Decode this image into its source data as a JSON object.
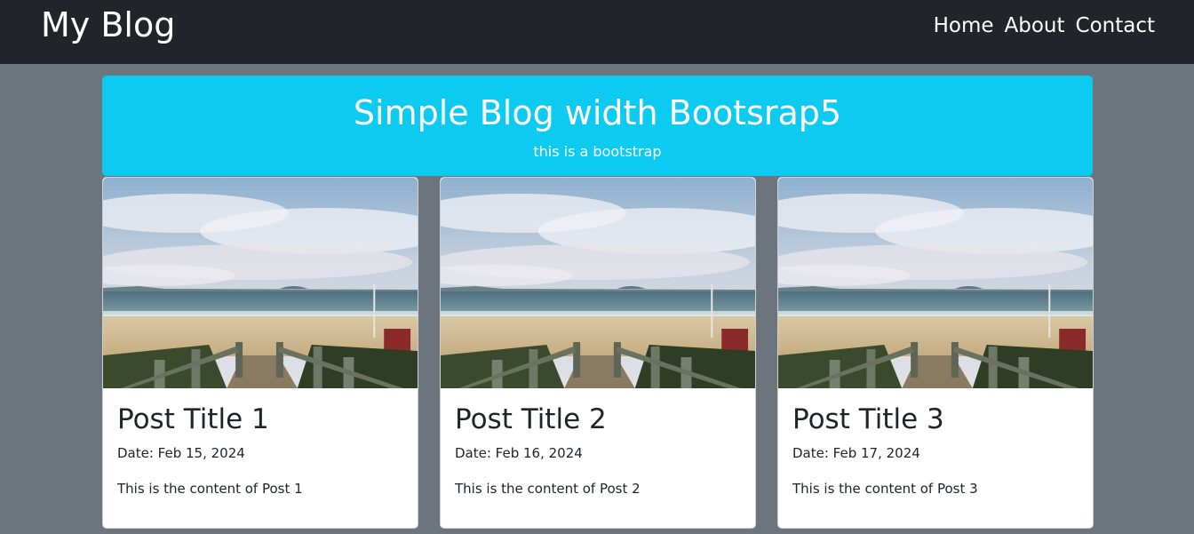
{
  "navbar": {
    "brand": "My Blog",
    "links": [
      "Home",
      "About",
      "Contact"
    ]
  },
  "hero": {
    "title": "Simple Blog width Bootsrap5",
    "subtitle": "this is a bootstrap"
  },
  "posts": [
    {
      "title": "Post Title 1",
      "date": "Date: Feb 15, 2024",
      "content": "This is the content of Post 1",
      "image": "beach-boardwalk-photo"
    },
    {
      "title": "Post Title 2",
      "date": "Date: Feb 16, 2024",
      "content": "This is the content of Post 2",
      "image": "beach-boardwalk-photo"
    },
    {
      "title": "Post Title 3",
      "date": "Date: Feb 17, 2024",
      "content": "This is the content of Post 3",
      "image": "beach-boardwalk-photo"
    }
  ],
  "colors": {
    "navbar_bg": "#212529",
    "page_bg": "#6c757d",
    "hero_bg": "#0dcaf0",
    "card_bg": "#ffffff",
    "text_dark": "#212529"
  }
}
